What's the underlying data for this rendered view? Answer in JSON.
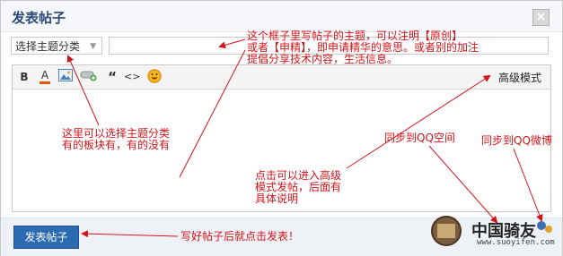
{
  "dialog": {
    "title": "发表帖子",
    "close_label": "×"
  },
  "category_select": {
    "value": "选择主题分类"
  },
  "subject_input": {
    "value": ""
  },
  "toolbar": {
    "bold": "B",
    "font_color": "A",
    "quote": "“",
    "code": "<>",
    "advanced_mode": "高级模式"
  },
  "footer": {
    "submit": "发表帖子"
  },
  "annotations": {
    "subject_note": "这个框子里写帖子的主题，可以注明【原创】\n或者【申精】，即申请精华的意思。或者别的加注\n提倡分享技术内容，生活信息。",
    "category_note": "这里可以选择主题分类\n有的板块有，有的没有",
    "advanced_note": "点击可以进入高级\n模式发帖，后面有\n具体说明",
    "qq_space_note": "同步到QQ空间",
    "qq_weibo_note": "同步到QQ微博",
    "submit_note": "写好帖子后就点击发表！"
  },
  "watermark": {
    "title": "中国骑友",
    "site": "www.suoyifen.com"
  },
  "colors": {
    "annotation": "#d2141a",
    "title": "#2b4b74",
    "submit_bg": "#2c6ab1"
  }
}
